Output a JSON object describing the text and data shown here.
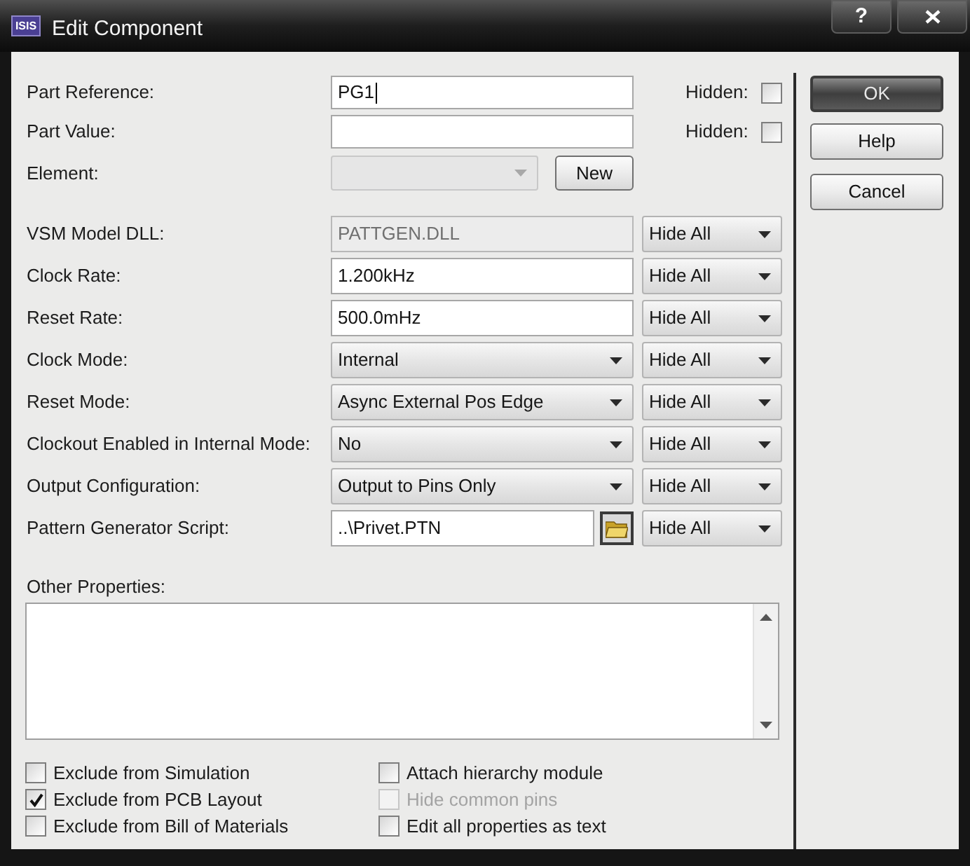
{
  "window": {
    "title": "Edit Component",
    "app_icon_label": "ISIS",
    "help_button": "?"
  },
  "top_fields": [
    {
      "kind": "text",
      "label": "Part Reference:",
      "value": "PG1",
      "focused": true,
      "disabled": false,
      "hidden_label": "Hidden:",
      "hidden_checked": false
    },
    {
      "kind": "text",
      "label": "Part Value:",
      "focused": false,
      "disabled": false,
      "hidden_label": "Hidden:",
      "hidden_checked": false
    },
    {
      "kind": "dropdown",
      "label": "Element:",
      "focused": false,
      "disabled": true,
      "button": "New"
    }
  ],
  "properties": [
    {
      "kind": "readonly",
      "label": "VSM Model DLL:",
      "value": "PATTGEN.DLL",
      "visibility": "Hide All"
    },
    {
      "kind": "text",
      "label": "Clock Rate:",
      "value": "1.200kHz",
      "visibility": "Hide All"
    },
    {
      "kind": "text",
      "label": "Reset Rate:",
      "value": "500.0mHz",
      "visibility": "Hide All"
    },
    {
      "kind": "dropdown",
      "label": "Clock Mode:",
      "value": "Internal",
      "visibility": "Hide All"
    },
    {
      "kind": "dropdown",
      "label": "Reset Mode:",
      "value": "Async External Pos Edge",
      "visibility": "Hide All"
    },
    {
      "kind": "dropdown",
      "label": "Clockout Enabled in Internal Mode:",
      "value": "No",
      "visibility": "Hide All"
    },
    {
      "kind": "dropdown",
      "label": "Output Configuration:",
      "value": "Output to Pins Only",
      "visibility": "Hide All"
    },
    {
      "kind": "file",
      "label": "Pattern Generator Script:",
      "value": "..\\Privet.PTN",
      "visibility": "Hide All"
    }
  ],
  "other_properties": {
    "label": "Other Properties:"
  },
  "option_columns": [
    {
      "items": [
        {
          "label": "Exclude from Simulation",
          "checked": false,
          "disabled": false
        },
        {
          "label": "Exclude from PCB Layout",
          "checked": true,
          "disabled": false
        },
        {
          "label": "Exclude from Bill of Materials",
          "checked": false,
          "disabled": false
        }
      ]
    },
    {
      "items": [
        {
          "label": "Attach hierarchy module",
          "checked": false,
          "disabled": false
        },
        {
          "label": "Hide common pins",
          "checked": false,
          "disabled": true
        },
        {
          "label": "Edit all properties as text",
          "checked": false,
          "disabled": false
        }
      ]
    }
  ],
  "buttons": [
    {
      "label": "OK",
      "default": true
    },
    {
      "label": "Help",
      "default": false
    },
    {
      "label": "Cancel",
      "default": false
    }
  ]
}
